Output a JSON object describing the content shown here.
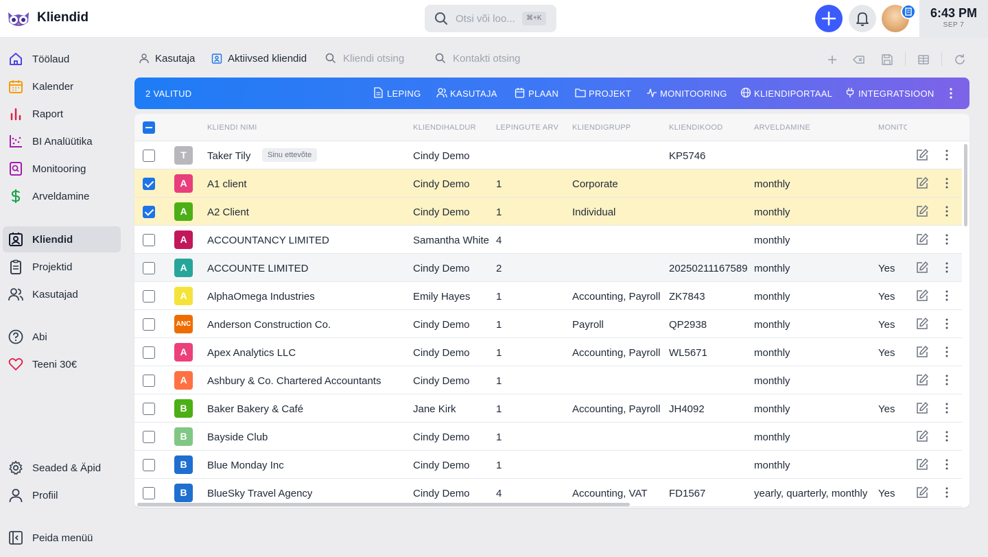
{
  "app": {
    "title": "Kliendid"
  },
  "search": {
    "placeholder": "Otsi või loo...",
    "shortcut": "⌘+K"
  },
  "clock": {
    "time": "6:43 PM",
    "date": "SEP 7"
  },
  "sidebar": {
    "items": [
      {
        "label": "Töölaud",
        "icon": "home-icon",
        "color": "#4f46e5"
      },
      {
        "label": "Kalender",
        "icon": "calendar-icon",
        "color": "#f59e0b"
      },
      {
        "label": "Raport",
        "icon": "bar-chart-icon",
        "color": "#e11d48"
      },
      {
        "label": "BI Analüütika",
        "icon": "scatter-chart-icon",
        "color": "#a21caf"
      },
      {
        "label": "Monitooring",
        "icon": "monitoring-icon",
        "color": "#a21caf"
      },
      {
        "label": "Arveldamine",
        "icon": "dollar-icon",
        "color": "#16a34a"
      },
      {
        "label": "Kliendid",
        "icon": "contact-card-icon",
        "color": "#111827"
      },
      {
        "label": "Projektid",
        "icon": "clipboard-icon",
        "color": "#374151"
      },
      {
        "label": "Kasutajad",
        "icon": "users-icon",
        "color": "#374151"
      },
      {
        "label": "Abi",
        "icon": "help-icon",
        "color": "#374151"
      },
      {
        "label": "Teeni 30€",
        "icon": "heart-icon",
        "color": "#e11d48"
      },
      {
        "label": "Seaded & Äpid",
        "icon": "gear-icon",
        "color": "#374151"
      },
      {
        "label": "Profiil",
        "icon": "user-icon",
        "color": "#374151"
      },
      {
        "label": "Peida menüü",
        "icon": "collapse-sidebar-icon",
        "color": "#374151"
      }
    ]
  },
  "tabs": {
    "user": "Kasutaja",
    "active_clients": "Aktiivsed kliendid",
    "client_search": "Kliendi otsing",
    "contact_search": "Kontakti otsing"
  },
  "action_bar": {
    "selected": "2 VALITUD",
    "actions": [
      "LEPING",
      "KASUTAJA",
      "PLAAN",
      "PROJEKT",
      "MONITOORING",
      "KLIENDIPORTAAL",
      "INTEGRATSIOON"
    ]
  },
  "table": {
    "headers": [
      "KLIENDI NIMI",
      "KLIENDIHALDUR",
      "LEPINGUTE ARV",
      "KLIENDIGRUPP",
      "KLIENDIKOOD",
      "ARVELDAMINE",
      "MONITOORING"
    ],
    "rows": [
      {
        "initial": "T",
        "color": "#b8b8bc",
        "name": "Taker Tily",
        "tag": "Sinu ettevõte",
        "manager": "Cindy Demo",
        "contracts": "",
        "group": "",
        "code": "KP5746",
        "billing": "",
        "monitoring": "",
        "checked": false
      },
      {
        "initial": "A",
        "color": "#e83e7c",
        "name": "A1 client",
        "tag": "",
        "manager": "Cindy Demo",
        "contracts": "1",
        "group": "Corporate",
        "code": "",
        "billing": "monthly",
        "monitoring": "",
        "checked": true
      },
      {
        "initial": "A",
        "color": "#4caf16",
        "name": "A2 Client",
        "tag": "",
        "manager": "Cindy Demo",
        "contracts": "1",
        "group": "Individual",
        "code": "",
        "billing": "monthly",
        "monitoring": "",
        "checked": true
      },
      {
        "initial": "A",
        "color": "#c2185b",
        "name": "ACCOUNTANCY LIMITED",
        "tag": "",
        "manager": "Samantha White",
        "contracts": "4",
        "group": "",
        "code": "",
        "billing": "monthly",
        "monitoring": "",
        "checked": false
      },
      {
        "initial": "A",
        "color": "#26a69a",
        "name": "ACCOUNTE LIMITED",
        "tag": "",
        "manager": "Cindy Demo",
        "contracts": "2",
        "group": "",
        "code": "20250211167589",
        "billing": "monthly",
        "monitoring": "Yes",
        "checked": false
      },
      {
        "initial": "A",
        "color": "#f5e33b",
        "name": "AlphaOmega Industries",
        "tag": "",
        "manager": "Emily Hayes",
        "contracts": "1",
        "group": "Accounting, Payroll",
        "code": "ZK7843",
        "billing": "monthly",
        "monitoring": "Yes",
        "checked": false
      },
      {
        "initial": "ANC",
        "color": "#ef6c00",
        "name": "Anderson Construction Co.",
        "tag": "",
        "manager": "Cindy Demo",
        "contracts": "1",
        "group": "Payroll",
        "code": "QP2938",
        "billing": "monthly",
        "monitoring": "Yes",
        "checked": false
      },
      {
        "initial": "A",
        "color": "#ec407a",
        "name": "Apex Analytics LLC",
        "tag": "",
        "manager": "Cindy Demo",
        "contracts": "1",
        "group": "Accounting, Payroll",
        "code": "WL5671",
        "billing": "monthly",
        "monitoring": "Yes",
        "checked": false
      },
      {
        "initial": "A",
        "color": "#ff7043",
        "name": "Ashbury & Co. Chartered Accountants",
        "tag": "",
        "manager": "Cindy Demo",
        "contracts": "1",
        "group": "",
        "code": "",
        "billing": "monthly",
        "monitoring": "",
        "checked": false
      },
      {
        "initial": "B",
        "color": "#4caf16",
        "name": "Baker Bakery & Café",
        "tag": "",
        "manager": "Jane Kirk",
        "contracts": "1",
        "group": "Accounting, Payroll",
        "code": "JH4092",
        "billing": "monthly",
        "monitoring": "Yes",
        "checked": false
      },
      {
        "initial": "B",
        "color": "#81c784",
        "name": "Bayside Club",
        "tag": "",
        "manager": "Cindy Demo",
        "contracts": "1",
        "group": "",
        "code": "",
        "billing": "monthly",
        "monitoring": "",
        "checked": false
      },
      {
        "initial": "B",
        "color": "#1e6fd0",
        "name": "Blue Monday Inc",
        "tag": "",
        "manager": "Cindy Demo",
        "contracts": "1",
        "group": "",
        "code": "",
        "billing": "monthly",
        "monitoring": "",
        "checked": false
      },
      {
        "initial": "B",
        "color": "#1e6fd0",
        "name": "BlueSky Travel Agency",
        "tag": "",
        "manager": "Cindy Demo",
        "contracts": "4",
        "group": "Accounting, VAT",
        "code": "FD1567",
        "billing": "yearly, quarterly, monthly",
        "monitoring": "Yes",
        "checked": false
      }
    ]
  }
}
